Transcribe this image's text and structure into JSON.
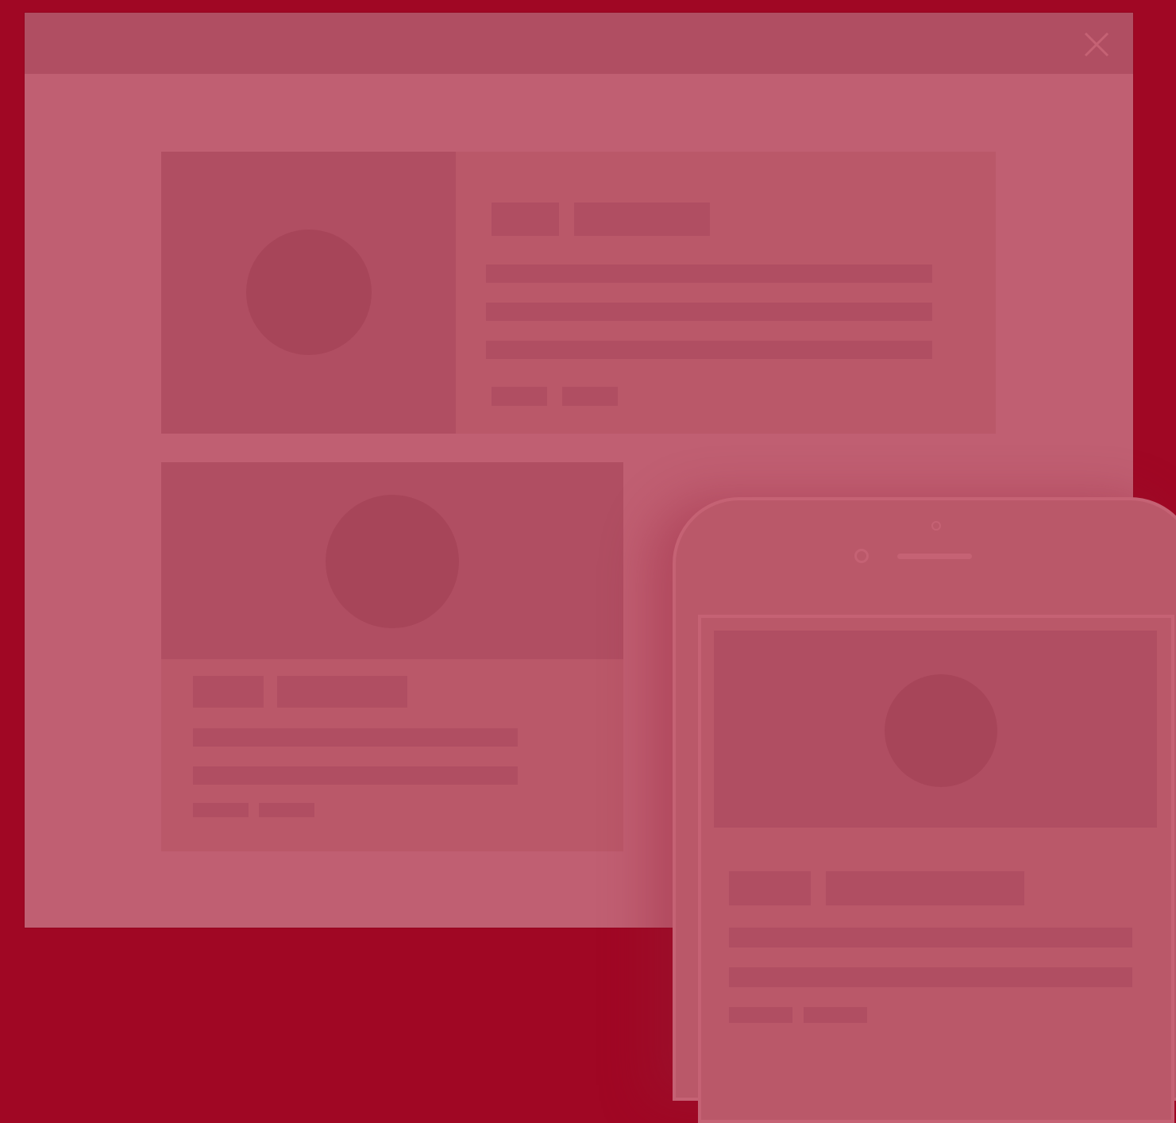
{
  "theme": {
    "background": "#a00724",
    "window": "#c05f72",
    "titlebar": "#b04e62",
    "card": "#ba5869",
    "placeholder": "#b04e62",
    "avatar": "#a74559",
    "device_outline": "#c56274"
  },
  "window": {
    "close_icon": "close-icon"
  },
  "cards": [
    {
      "layout": "horizontal",
      "image": "placeholder-image-icon",
      "tags": 2,
      "text_lines": 3,
      "buttons": 2
    },
    {
      "layout": "vertical",
      "image": "placeholder-image-icon",
      "tags": 2,
      "text_lines": 2,
      "buttons": 2
    }
  ],
  "phone": {
    "card": {
      "layout": "vertical",
      "image": "placeholder-image-icon",
      "tags": 2,
      "text_lines": 2,
      "buttons": 2
    }
  }
}
